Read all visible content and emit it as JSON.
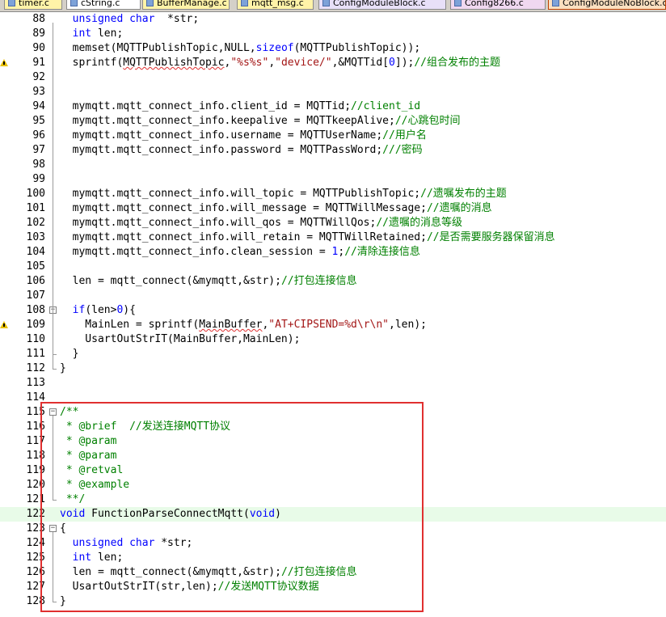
{
  "tabs": [
    {
      "label": "timer.c",
      "active": false
    },
    {
      "label": "cString.c",
      "active": false
    },
    {
      "label": "BufferManage.c",
      "active": false
    },
    {
      "label": "mqtt_msg.c",
      "active": false
    },
    {
      "label": "ConfigModuleBlock.c",
      "active": false
    },
    {
      "label": "Config8266.c",
      "active": false
    },
    {
      "label": "ConfigModuleNoBlock.c",
      "active": true
    }
  ],
  "colors": {
    "keyword": "#0000ff",
    "comment": "#008000",
    "string": "#a31515",
    "highlight_line": "#e8fbe8",
    "annotation_box": "#e03030",
    "warning": "#e8c000"
  },
  "lines": [
    {
      "n": "88",
      "tokens": [
        [
          "kw",
          "  unsigned char"
        ],
        [
          "",
          "  *str;"
        ]
      ]
    },
    {
      "n": "89",
      "tokens": [
        [
          "kw",
          "  int"
        ],
        [
          "",
          " len;"
        ]
      ]
    },
    {
      "n": "90",
      "tokens": [
        [
          "",
          "  memset(MQTTPublishTopic,NULL,"
        ],
        [
          "kw",
          "sizeof"
        ],
        [
          "",
          "(MQTTPublishTopic));"
        ]
      ]
    },
    {
      "n": "91",
      "warn": true,
      "tokens": [
        [
          "",
          "  sprintf("
        ],
        [
          "sq",
          "MQTTPublishTopic"
        ],
        [
          "",
          ","
        ],
        [
          "str",
          "\"%s%s\""
        ],
        [
          "",
          ","
        ],
        [
          "str",
          "\"device/\""
        ],
        [
          "",
          ",&MQTTid["
        ],
        [
          "num",
          "0"
        ],
        [
          "",
          "]);"
        ],
        [
          "cm",
          "//组合发布的主题"
        ]
      ]
    },
    {
      "n": "92",
      "tokens": []
    },
    {
      "n": "93",
      "tokens": []
    },
    {
      "n": "94",
      "tokens": [
        [
          "",
          "  mymqtt.mqtt_connect_info.client_id = MQTTid;"
        ],
        [
          "cm",
          "//client_id"
        ]
      ]
    },
    {
      "n": "95",
      "tokens": [
        [
          "",
          "  mymqtt.mqtt_connect_info.keepalive = MQTTkeepAlive;"
        ],
        [
          "cm",
          "//心跳包时间"
        ]
      ]
    },
    {
      "n": "96",
      "tokens": [
        [
          "",
          "  mymqtt.mqtt_connect_info.username = MQTTUserName;"
        ],
        [
          "cm",
          "//用户名"
        ]
      ]
    },
    {
      "n": "97",
      "tokens": [
        [
          "",
          "  mymqtt.mqtt_connect_info.password = MQTTPassWord;"
        ],
        [
          "cm",
          "///密码"
        ]
      ]
    },
    {
      "n": "98",
      "tokens": []
    },
    {
      "n": "99",
      "tokens": []
    },
    {
      "n": "100",
      "tokens": [
        [
          "",
          "  mymqtt.mqtt_connect_info.will_topic = MQTTPublishTopic;"
        ],
        [
          "cm",
          "//遗嘱发布的主题"
        ]
      ]
    },
    {
      "n": "101",
      "tokens": [
        [
          "",
          "  mymqtt.mqtt_connect_info.will_message = MQTTWillMessage;"
        ],
        [
          "cm",
          "//遗嘱的消息"
        ]
      ]
    },
    {
      "n": "102",
      "tokens": [
        [
          "",
          "  mymqtt.mqtt_connect_info.will_qos = MQTTWillQos;"
        ],
        [
          "cm",
          "//遗嘱的消息等级"
        ]
      ]
    },
    {
      "n": "103",
      "tokens": [
        [
          "",
          "  mymqtt.mqtt_connect_info.will_retain = MQTTWillRetained;"
        ],
        [
          "cm",
          "//是否需要服务器保留消息"
        ]
      ]
    },
    {
      "n": "104",
      "tokens": [
        [
          "",
          "  mymqtt.mqtt_connect_info.clean_session = "
        ],
        [
          "num",
          "1"
        ],
        [
          "",
          ";"
        ],
        [
          "cm",
          "//清除连接信息"
        ]
      ]
    },
    {
      "n": "105",
      "tokens": []
    },
    {
      "n": "106",
      "tokens": [
        [
          "",
          "  len = mqtt_connect(&mymqtt,&str);"
        ],
        [
          "cm",
          "//打包连接信息"
        ]
      ]
    },
    {
      "n": "107",
      "tokens": []
    },
    {
      "n": "108",
      "fold": "-",
      "tokens": [
        [
          "kw",
          "  if"
        ],
        [
          "",
          "(len>"
        ],
        [
          "num",
          "0"
        ],
        [
          "",
          ")"
        ],
        [
          "",
          "{"
        ]
      ]
    },
    {
      "n": "109",
      "warn": true,
      "tokens": [
        [
          "",
          "    MainLen = sprintf("
        ],
        [
          "sq",
          "MainBuffer"
        ],
        [
          "",
          ","
        ],
        [
          "str",
          "\"AT+CIPSEND=%d\\r\\n\""
        ],
        [
          "",
          ",len);"
        ]
      ]
    },
    {
      "n": "110",
      "tokens": [
        [
          "",
          "    UsartOutStrIT(MainBuffer,MainLen);"
        ]
      ]
    },
    {
      "n": "111",
      "tokens": [
        [
          "",
          "  }"
        ]
      ]
    },
    {
      "n": "112",
      "tokens": [
        [
          "",
          "}"
        ]
      ]
    },
    {
      "n": "113",
      "tokens": []
    },
    {
      "n": "114",
      "tokens": []
    },
    {
      "n": "115",
      "fold": "-",
      "tokens": [
        [
          "cm",
          "/**"
        ]
      ]
    },
    {
      "n": "116",
      "tokens": [
        [
          "cm",
          " * @brief  //发送连接MQTT协议"
        ]
      ]
    },
    {
      "n": "117",
      "tokens": [
        [
          "cm",
          " * @param"
        ]
      ]
    },
    {
      "n": "118",
      "tokens": [
        [
          "cm",
          " * @param"
        ]
      ]
    },
    {
      "n": "119",
      "tokens": [
        [
          "cm",
          " * @retval"
        ]
      ]
    },
    {
      "n": "120",
      "tokens": [
        [
          "cm",
          " * @example"
        ]
      ]
    },
    {
      "n": "121",
      "tokens": [
        [
          "cm",
          " **/"
        ]
      ]
    },
    {
      "n": "122",
      "hl": true,
      "tokens": [
        [
          "kw",
          "void"
        ],
        [
          "",
          " FunctionParseConnectMqtt("
        ],
        [
          "kw",
          "void"
        ],
        [
          "",
          ")"
        ]
      ]
    },
    {
      "n": "123",
      "fold": "-",
      "tokens": [
        [
          "",
          "{"
        ]
      ]
    },
    {
      "n": "124",
      "tokens": [
        [
          "kw",
          "  unsigned char"
        ],
        [
          "",
          " *str;"
        ]
      ]
    },
    {
      "n": "125",
      "tokens": [
        [
          "kw",
          "  int"
        ],
        [
          "",
          " len;"
        ]
      ]
    },
    {
      "n": "126",
      "tokens": [
        [
          "",
          "  len = mqtt_connect(&mymqtt,&str);"
        ],
        [
          "cm",
          "//打包连接信息"
        ]
      ]
    },
    {
      "n": "127",
      "tokens": [
        [
          "",
          "  UsartOutStrIT(str,len);"
        ],
        [
          "cm",
          "//发送MQTT协议数据"
        ]
      ]
    },
    {
      "n": "128",
      "tokens": [
        [
          "",
          "}"
        ]
      ]
    }
  ]
}
